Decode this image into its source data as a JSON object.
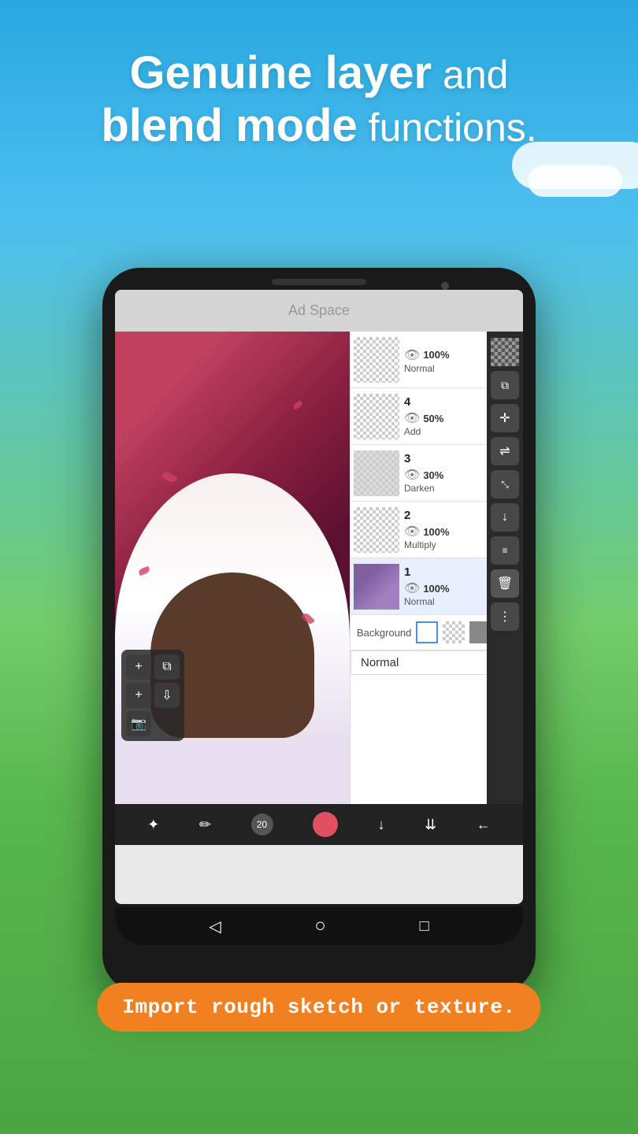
{
  "header": {
    "line1_bold": "Genuine layer",
    "line1_light": " and",
    "line2_bold": "blend mode",
    "line2_light": " functions."
  },
  "ad": {
    "label": "Ad Space"
  },
  "layers": [
    {
      "number": "",
      "opacity": "100%",
      "mode": "Normal",
      "has_content": false
    },
    {
      "number": "4",
      "opacity": "50%",
      "mode": "Add",
      "has_content": true
    },
    {
      "number": "3",
      "opacity": "30%",
      "mode": "Darken",
      "has_content": true
    },
    {
      "number": "2",
      "opacity": "100%",
      "mode": "Multiply",
      "has_content": true
    },
    {
      "number": "1",
      "opacity": "100%",
      "mode": "Normal",
      "has_content": true
    }
  ],
  "background_label": "Background",
  "blend_mode_label": "Normal",
  "banner": {
    "text": "Import rough sketch or texture."
  },
  "toolbar": {
    "add_label": "+",
    "add_layer_label": "+"
  },
  "nav": {
    "back": "◁",
    "home": "○",
    "square": "□"
  }
}
